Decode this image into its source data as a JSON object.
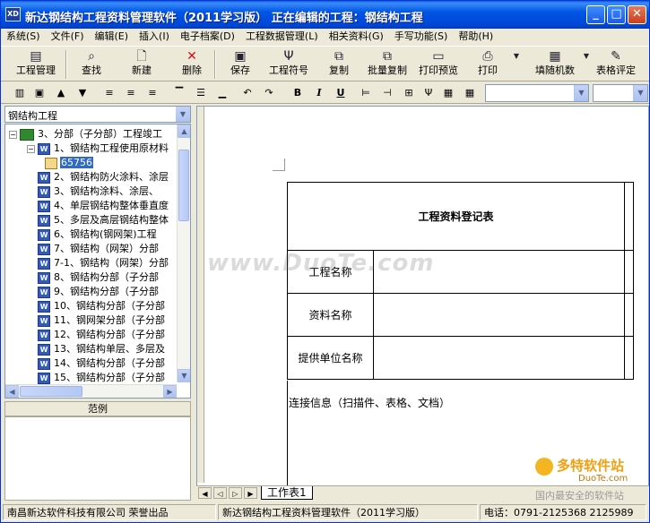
{
  "window": {
    "title": "新达钢结构工程资料管理软件（2011学习版）    正在编辑的工程：钢结构工程",
    "app_icon": "XD",
    "minimize_glyph": "_",
    "maximize_glyph": "□",
    "close_glyph": "✕"
  },
  "menu": [
    "系统(S)",
    "文件(F)",
    "编辑(E)",
    "插入(I)",
    "电子档案(D)",
    "工程数据管理(L)",
    "相关资料(G)",
    "手写功能(S)",
    "帮助(H)"
  ],
  "toolbar": {
    "project_mgmt": "工程管理",
    "find": "查找",
    "new": "新建",
    "delete": "删除",
    "save": "保存",
    "symbol": "工程符号",
    "copy": "复制",
    "batch_copy": "批量复制",
    "print_preview": "打印预览",
    "print": "打印",
    "fill_random": "填随机数",
    "table_eval": "表格评定"
  },
  "format_toolbar": {
    "bold": "B",
    "italic": "I",
    "underline": "U",
    "font_combo": "",
    "size_combo": ""
  },
  "left_pane": {
    "project_select": "钢结构工程",
    "tree": [
      {
        "label": "3、分部（子分部）工程竣工",
        "level": 0,
        "expand": "−",
        "icon": "book"
      },
      {
        "label": "1、钢结构工程使用原材料",
        "level": 1,
        "expand": "−",
        "icon": "word"
      },
      {
        "label": "65756",
        "level": 2,
        "expand": "",
        "icon": "doc",
        "selected": true
      },
      {
        "label": "2、钢结构防火涂料、涂层",
        "level": 1,
        "expand": "",
        "icon": "word"
      },
      {
        "label": "3、钢结构涂料、涂层、",
        "level": 1,
        "expand": "",
        "icon": "word"
      },
      {
        "label": "4、单层钢结构整体垂直度",
        "level": 1,
        "expand": "",
        "icon": "word"
      },
      {
        "label": "5、多层及高层钢结构整体",
        "level": 1,
        "expand": "",
        "icon": "word"
      },
      {
        "label": "6、钢结构(钢网架)工程",
        "level": 1,
        "expand": "",
        "icon": "word"
      },
      {
        "label": "7、钢结构（网架）分部",
        "level": 1,
        "expand": "",
        "icon": "word"
      },
      {
        "label": "7-1、钢结构（网架）分部",
        "level": 1,
        "expand": "",
        "icon": "word"
      },
      {
        "label": "8、钢结构分部（子分部",
        "level": 1,
        "expand": "",
        "icon": "word"
      },
      {
        "label": "9、钢结构分部（子分部",
        "level": 1,
        "expand": "",
        "icon": "word"
      },
      {
        "label": "10、钢结构分部（子分部",
        "level": 1,
        "expand": "",
        "icon": "word"
      },
      {
        "label": "11、钢网架分部（子分部",
        "level": 1,
        "expand": "",
        "icon": "word"
      },
      {
        "label": "12、钢结构分部（子分部",
        "level": 1,
        "expand": "",
        "icon": "word"
      },
      {
        "label": "13、钢结构单层、多层及",
        "level": 1,
        "expand": "",
        "icon": "word"
      },
      {
        "label": "14、钢结构分部（子分部",
        "level": 1,
        "expand": "",
        "icon": "word"
      },
      {
        "label": "15、钢结构分部（子分部",
        "level": 1,
        "expand": "",
        "icon": "word"
      }
    ],
    "legend_header": "范例"
  },
  "document": {
    "form_title": "工程资料登记表",
    "rows": [
      {
        "label": "工程名称",
        "value": ""
      },
      {
        "label": "资料名称",
        "value": ""
      },
      {
        "label": "提供单位名称",
        "value": ""
      }
    ],
    "connection_info": "连接信息（扫描件、表格、文档）",
    "sheet_tab": "工作表1"
  },
  "status": {
    "company": "南昌新达软件科技有限公司  荣誉出品",
    "product": "新达钢结构工程资料管理软件（2011学习版）",
    "phone": "电话：0791-2125368 2125989"
  },
  "watermark": {
    "text": "www.DuoTe.com",
    "logo_text": "多特软件站",
    "logo_sub": "DuoTe.com",
    "logo_tagline": "国内最安全的软件站"
  },
  "colors": {
    "titlebar": "#0055e5",
    "selection": "#316ac5",
    "chrome": "#ece9d8"
  }
}
